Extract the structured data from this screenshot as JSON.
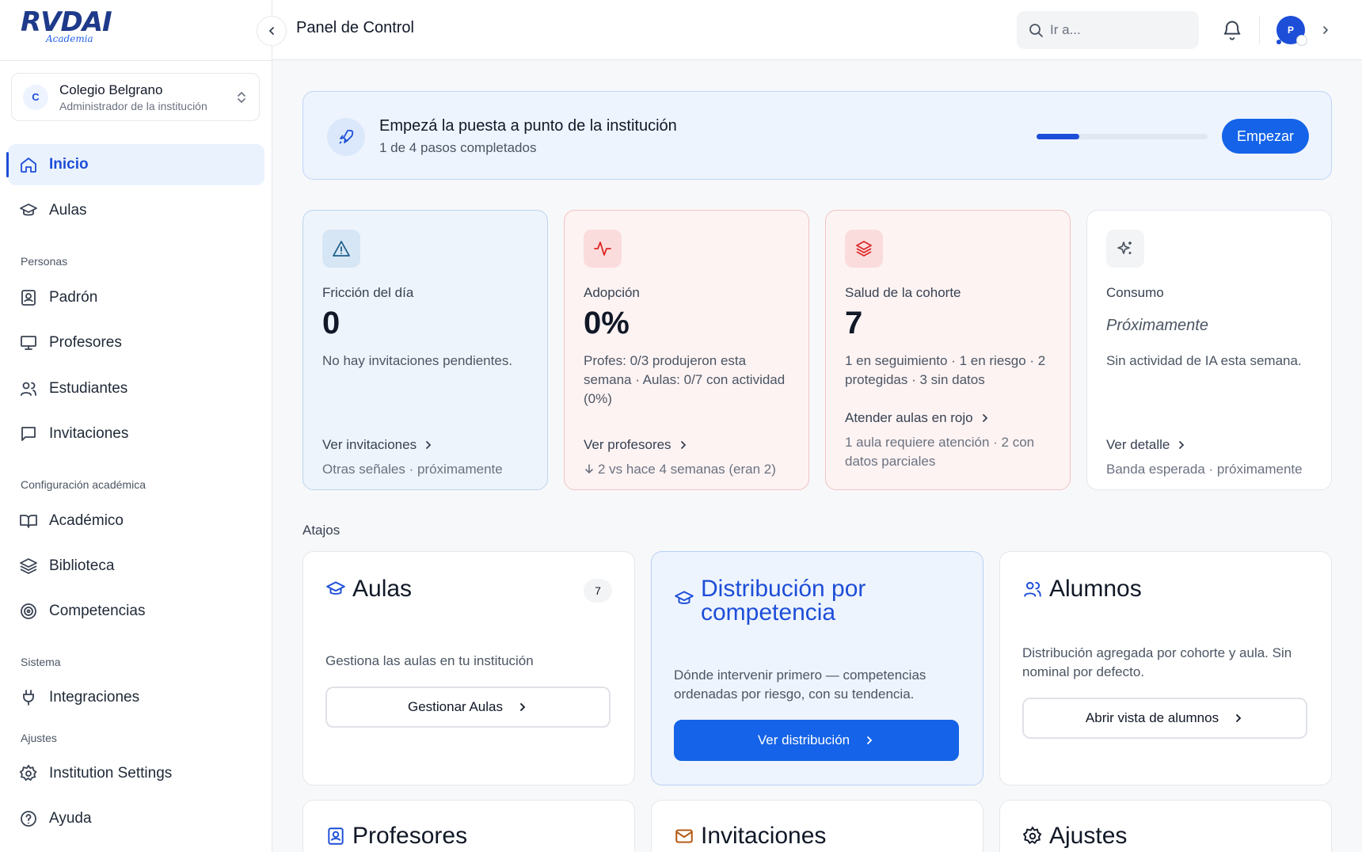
{
  "brand": {
    "logo_text": "RVDAI",
    "logo_sub": "Academia"
  },
  "sidebar": {
    "institution": {
      "initial": "C",
      "name": "Colegio Belgrano",
      "role": "Administrador de la institución"
    },
    "items": [
      {
        "label": "Inicio",
        "icon": "home-icon",
        "active": true
      },
      {
        "label": "Aulas",
        "icon": "graduation-cap-icon"
      },
      {
        "label": "Padrón",
        "icon": "contact-book-icon"
      },
      {
        "label": "Profesores",
        "icon": "presentation-icon"
      },
      {
        "label": "Estudiantes",
        "icon": "users-icon"
      },
      {
        "label": "Invitaciones",
        "icon": "message-square-icon"
      },
      {
        "label": "Académico",
        "icon": "book-open-icon"
      },
      {
        "label": "Biblioteca",
        "icon": "layers-icon"
      },
      {
        "label": "Competencias",
        "icon": "target-icon"
      },
      {
        "label": "Integraciones",
        "icon": "plug-icon"
      },
      {
        "label": "Institution Settings",
        "icon": "gear-icon"
      },
      {
        "label": "Ayuda",
        "icon": "help-circle-icon"
      }
    ],
    "sections": {
      "personas": "Personas",
      "config": "Configuración académica",
      "sistema": "Sistema",
      "ajustes": "Ajustes"
    }
  },
  "header": {
    "title": "Panel de Control",
    "search_placeholder": "Ir a...",
    "avatar_initial": "P"
  },
  "onboarding": {
    "title": "Empezá la puesta a punto de la institución",
    "subtitle": "1 de 4 pasos completados",
    "progress": 0.25,
    "button": "Empezar"
  },
  "metrics": [
    {
      "label": "Fricción del día",
      "value": "0",
      "desc": "No hay invitaciones pendientes.",
      "link": "Ver invitaciones",
      "foot": "Otras señales · próximamente"
    },
    {
      "label": "Adopción",
      "value": "0%",
      "desc": "Profes: 0/3 produjeron esta semana · Aulas: 0/7 con actividad (0%)",
      "link": "Ver profesores",
      "foot": "2 vs hace 4 semanas (eran 2)"
    },
    {
      "label": "Salud de la cohorte",
      "value": "7",
      "desc": "1 en seguimiento · 1 en riesgo · 2 protegidas · 3 sin datos",
      "link": "Atender aulas en rojo",
      "foot": "1 aula requiere atención · 2 con datos parciales"
    },
    {
      "label": "Consumo",
      "value": "Próximamente",
      "desc": "Sin actividad de IA esta semana.",
      "link": "Ver detalle",
      "foot": "Banda esperada · próximamente"
    }
  ],
  "shortcuts_label": "Atajos",
  "shortcuts": [
    {
      "title": "Aulas",
      "count": "7",
      "desc": "Gestiona las aulas en tu institución",
      "button": "Gestionar Aulas"
    },
    {
      "title": "Distribución por competencia",
      "desc": "Dónde intervenir primero — competencias ordenadas por riesgo, con su tendencia.",
      "button": "Ver distribución"
    },
    {
      "title": "Alumnos",
      "desc": "Distribución agregada por cohorte y aula. Sin nominal por defecto.",
      "button": "Abrir vista de alumnos"
    },
    {
      "title": "Profesores"
    },
    {
      "title": "Invitaciones"
    },
    {
      "title": "Ajustes"
    }
  ],
  "colors": {
    "accent": "#1463e8",
    "danger": "#dc2626",
    "info_bg": "#eef4fd"
  }
}
